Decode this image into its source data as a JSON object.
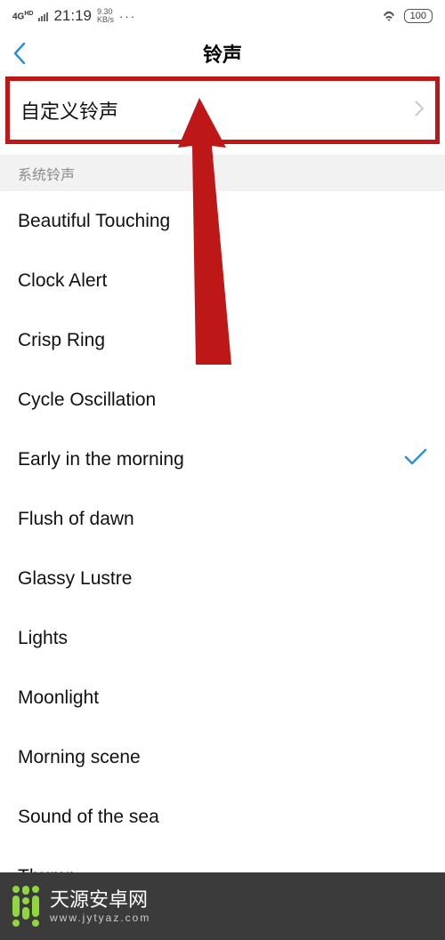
{
  "status": {
    "net": "4G",
    "hd": "HD",
    "time": "21:19",
    "speed_top": "9.30",
    "speed_bot": "KB/s",
    "dots": "···",
    "battery": "100"
  },
  "header": {
    "title": "铃声"
  },
  "custom": {
    "label": "自定义铃声"
  },
  "section": {
    "system_label": "系统铃声"
  },
  "ringtones": [
    {
      "label": "Beautiful Touching",
      "selected": false
    },
    {
      "label": "Clock Alert",
      "selected": false
    },
    {
      "label": "Crisp Ring",
      "selected": false
    },
    {
      "label": "Cycle Oscillation",
      "selected": false
    },
    {
      "label": "Early in the morning",
      "selected": true
    },
    {
      "label": "Flush of dawn",
      "selected": false
    },
    {
      "label": "Glassy Lustre",
      "selected": false
    },
    {
      "label": "Lights",
      "selected": false
    },
    {
      "label": "Moonlight",
      "selected": false
    },
    {
      "label": "Morning scene",
      "selected": false
    },
    {
      "label": "Sound of the sea",
      "selected": false
    },
    {
      "label": "Thump",
      "selected": false
    }
  ],
  "footer": {
    "brand": "天源安卓网",
    "url": "www.jytyaz.com"
  }
}
